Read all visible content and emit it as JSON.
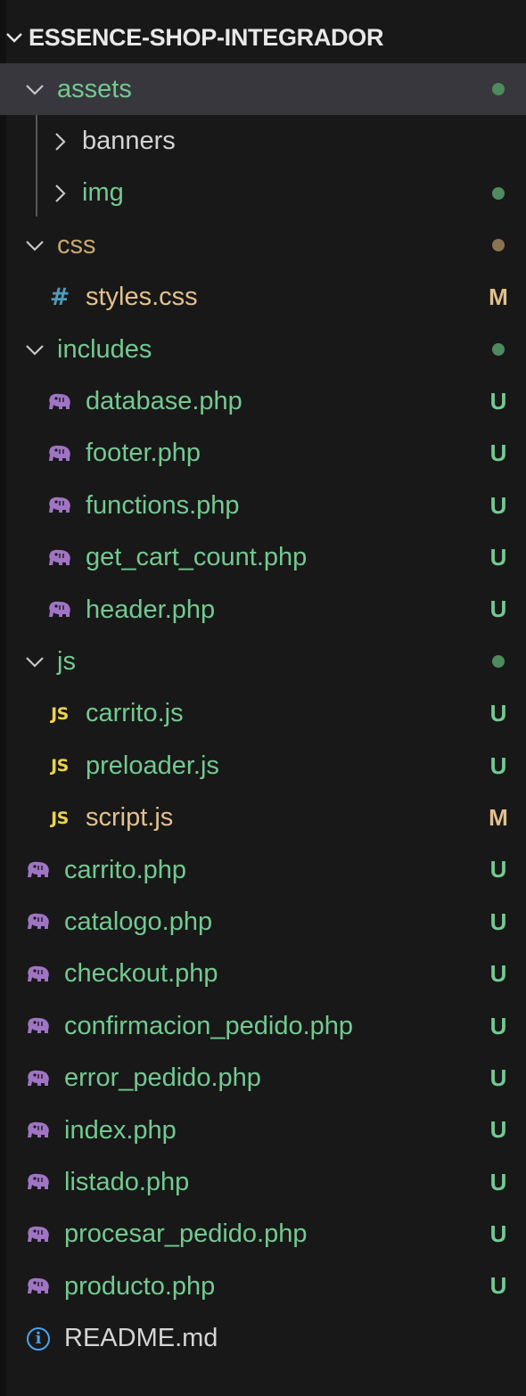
{
  "explorer": {
    "root_label": "ESSENCE-SHOP-INTEGRADOR",
    "colors": {
      "background": "#181818",
      "selected_row": "#37373d",
      "untracked": "#73c991",
      "modified": "#e2c08d",
      "folder_green": "#73c991",
      "folder_modified": "#c9a76d",
      "php_icon": "#a074c4",
      "js_icon": "#e9d44c",
      "css_icon": "#519aba",
      "info_icon": "#4aa3ef",
      "plain_text": "#d4d4d4"
    },
    "items": [
      {
        "label": "assets",
        "type": "folder",
        "expanded": true,
        "depth": 1,
        "badge": "",
        "dot": "green",
        "selected": true
      },
      {
        "label": "banners",
        "type": "folder",
        "expanded": false,
        "depth": 2,
        "badge": "",
        "dot": "none"
      },
      {
        "label": "img",
        "type": "folder",
        "expanded": false,
        "depth": 2,
        "badge": "",
        "dot": "green"
      },
      {
        "label": "css",
        "type": "folder",
        "expanded": true,
        "depth": 1,
        "badge": "",
        "dot": "brown"
      },
      {
        "label": "styles.css",
        "type": "file",
        "icon": "hash-icon",
        "depth": 2,
        "badge": "M"
      },
      {
        "label": "includes",
        "type": "folder",
        "expanded": true,
        "depth": 1,
        "badge": "",
        "dot": "green"
      },
      {
        "label": "database.php",
        "type": "file",
        "icon": "php-elephant-icon",
        "depth": 2,
        "badge": "U"
      },
      {
        "label": "footer.php",
        "type": "file",
        "icon": "php-elephant-icon",
        "depth": 2,
        "badge": "U"
      },
      {
        "label": "functions.php",
        "type": "file",
        "icon": "php-elephant-icon",
        "depth": 2,
        "badge": "U"
      },
      {
        "label": "get_cart_count.php",
        "type": "file",
        "icon": "php-elephant-icon",
        "depth": 2,
        "badge": "U"
      },
      {
        "label": "header.php",
        "type": "file",
        "icon": "php-elephant-icon",
        "depth": 2,
        "badge": "U"
      },
      {
        "label": "js",
        "type": "folder",
        "expanded": true,
        "depth": 1,
        "badge": "",
        "dot": "green"
      },
      {
        "label": "carrito.js",
        "type": "file",
        "icon": "js-icon",
        "depth": 2,
        "badge": "U"
      },
      {
        "label": "preloader.js",
        "type": "file",
        "icon": "js-icon",
        "depth": 2,
        "badge": "U"
      },
      {
        "label": "script.js",
        "type": "file",
        "icon": "js-icon",
        "depth": 2,
        "badge": "M"
      },
      {
        "label": "carrito.php",
        "type": "file",
        "icon": "php-elephant-icon",
        "depth": 1,
        "badge": "U"
      },
      {
        "label": "catalogo.php",
        "type": "file",
        "icon": "php-elephant-icon",
        "depth": 1,
        "badge": "U"
      },
      {
        "label": "checkout.php",
        "type": "file",
        "icon": "php-elephant-icon",
        "depth": 1,
        "badge": "U"
      },
      {
        "label": "confirmacion_pedido.php",
        "type": "file",
        "icon": "php-elephant-icon",
        "depth": 1,
        "badge": "U"
      },
      {
        "label": "error_pedido.php",
        "type": "file",
        "icon": "php-elephant-icon",
        "depth": 1,
        "badge": "U"
      },
      {
        "label": "index.php",
        "type": "file",
        "icon": "php-elephant-icon",
        "depth": 1,
        "badge": "U"
      },
      {
        "label": "listado.php",
        "type": "file",
        "icon": "php-elephant-icon",
        "depth": 1,
        "badge": "U"
      },
      {
        "label": "procesar_pedido.php",
        "type": "file",
        "icon": "php-elephant-icon",
        "depth": 1,
        "badge": "U"
      },
      {
        "label": "producto.php",
        "type": "file",
        "icon": "php-elephant-icon",
        "depth": 1,
        "badge": "U"
      },
      {
        "label": "README.md",
        "type": "file",
        "icon": "info-icon",
        "depth": 1,
        "badge": ""
      }
    ]
  }
}
